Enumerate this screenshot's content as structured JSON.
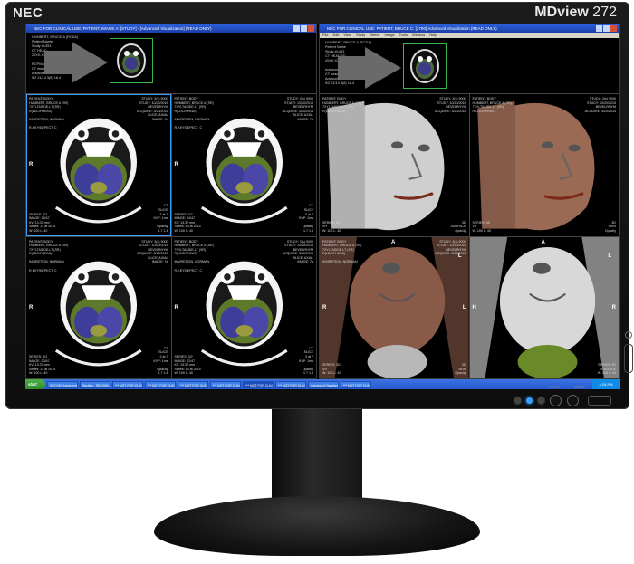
{
  "monitor": {
    "brand": "NEC",
    "model_prefix": "MDview",
    "model_number": "272",
    "button_labels": [
      "INPUT",
      "MENU"
    ]
  },
  "left_viewer": {
    "title": "NEC FOR CLINICAL USE: PATIENT, IMAGE A: [STUDY] - [Advanced Visualization] (READ ONLY)",
    "header_text": "HUMBERT, BRUCE A (RCDA)\nPatient Name\nStudy #1453\nCT HEAD\n20XX-XX-XX 15:28\n\nRCPI/Medical Systems\nCT head No Contrast\nAdvanced Reader\n9/2 21/14 3(8) 18.4",
    "accent_color": "#39b54a",
    "images": [
      {
        "tl": "PATIENT: BODY\nHUMBERT, BRUCE A (SR)\n7XYLTASIDE-LT (SR)\nR(LDC/PHEAS)\n\nINVIRETION, NORMAN\n\nR-KEYSIEPECT, C",
        "tr": "STUDY: 3(s) 9000\nSTUDY: 10/20/2015\nBEVELRHYM\nACQUIRE: 3/20/2015\nSLICE: AXIAL\nIMAGE: 7a",
        "bl": "SERIES: 3/2\nIMAGE: 25/47\nKV: 13.37 mm\nSeries: 13 at 2015\nW: 100 L: 40",
        "br": "CT\nSLICE\n3 at 7\nKVP: 1ms\n\nOpacity\n1.7 1.4",
        "orient": "R"
      },
      {
        "tl": "PATIENT: BODY\nHUMBERT, BRUCE A (SR)\n7XYLTASIDE-LT (SR)\nR(LDC/PHEAS)\n\nINVIRETION, NORMAN\n\nR-KEYSIEPECT, C",
        "tr": "STUDY: 3(s) 9000\nSTUDY: 10/20/2015\nBEVELRHYM\nACQUIRE: 3/20/2015\nSLICE: AXIAL\nIMAGE: 7a",
        "bl": "SERIES: 3/2\nIMAGE: 24/47\nKV: 13.37 mm\nSeries: 13 at 2015\nW: 100 L: 40",
        "br": "CT\nSLICE\n3 at 7\nKVP: 1ms\n\nOpacity\n1.7 1.4",
        "orient": "R"
      },
      {
        "tl": "PATIENT: BODY\nHUMBERT, BRUCE A (SR)\n7XYLTASIDE-LT (SR)\nR(LDC/PHEAS)\n\nINVIRETION, NORMAN\n\nR-KEYSIEPECT, C",
        "tr": "STUDY: 3(s) 9000\nSTUDY: 10/20/2015\nBEVELRHYM\nACQUIRE: 3/20/2015\nSLICE: AXIAL\nIMAGE: 7a",
        "bl": "SERIES: 3/2\nIMAGE: 23/47\nKV: 13.37 mm\nSeries: 13 at 2015\nW: 100 L: 40",
        "br": "CT\nSLICE\n3 at 7\nKVP: 1ms\n\nOpacity\n1.7 1.4",
        "orient": "R"
      },
      {
        "tl": "PATIENT: BODY\nHUMBERT, BRUCE A (SR)\n7XYLTASIDE-LT (SR)\nR(LDC/PHEAS)\n\nINVIRETION, NORMAN\n\nR-KEYSIEPECT, C",
        "tr": "STUDY: 3(s) 9000\nSTUDY: 10/20/2015\nBEVELRHYM\nACQUIRE: 3/20/2015\nSLICE: AXIAL\nIMAGE: 7a",
        "bl": "SERIES: 3/2\nIMAGE: 22/47\nKV: 13.37 mm\nSeries: 13 at 2015\nW: 100 L: 40",
        "br": "CT\nSLICE\n3 at 7\nKVP: 1ms\n\nOpacity\n1.7 1.4",
        "orient": "R"
      }
    ]
  },
  "right_viewer": {
    "title": "NEC FOR CLINICAL USE: PATIENT, BRUCE C: [3790] Advanced Visualization (READ ONLY)",
    "menu": [
      "File",
      "Edit",
      "View",
      "Study",
      "Series",
      "Image",
      "Tools",
      "Window",
      "Help"
    ],
    "header_text": "HUMBERT, BRUCE A (RCDA)\nPatient Name\nStudy #1453\nCT HEAD 3D\n20XX-XX-XX 15:28\n\nAdvanced Medical Systems\nCT head No Contrast\nAdvanced Reader\n9/2 21/14 3(8) 18.4",
    "images": [
      {
        "tl": "PATIENT: BODY\nHUMBERT, BRUCE A (SR)\n7XYLTASIDE-LT (SR)\nR(LDC/PHEAS)",
        "tr": "STUDY: 3(s) 9000\nSTUDY: 10/20/2015\nBEVELRHYM\nACQUIRE: 3/20/2015",
        "bl": "SERIES: 3D\nVR\nW: 100 L: 40",
        "br": "3D\nSURFACE\nOpacity",
        "labels": []
      },
      {
        "tl": "PATIENT: BODY\nHUMBERT, BRUCE A (SR)\n7XYLTASIDE-LT (SR)\nR(LDC/PHEAS)",
        "tr": "STUDY: 3(s) 9000\nSTUDY: 10/20/2015\nBEVELRHYM\nACQUIRE: 3/20/2015",
        "bl": "SERIES: 3D\nVR\nW: 100 L: 40",
        "br": "3D\nSKIN\nOpacity",
        "labels": []
      },
      {
        "tl": "PATIENT: BODY\nHUMBERT, BRUCE A (SR)\n7XYLTASIDE-LT (SR)\nR(LDC/PHEAS)\n\nINVIRETION, NORMAN",
        "tr": "STUDY: 3(s) 9000\nSTUDY: 10/20/2015\nBEVELRHYM\nACQUIRE: 3/20/2015",
        "bl": "SERIES: 3D\nVR\nW: 100 L: 40",
        "br": "3D\nSKIN\nOpacity",
        "labels": [
          "A",
          "R",
          "L",
          "L"
        ]
      },
      {
        "tl": "",
        "tr": "",
        "bl": "",
        "br": "SERIES: 3D\nSURFACE\nW: 100 L: 40",
        "labels": [
          "A",
          "H",
          "R",
          "L"
        ]
      }
    ]
  },
  "taskbar": {
    "start_label": "start",
    "items": [
      "[DICOM] Advanced Vis...",
      "Studies - [DICOM] Adv...",
      "*** NOT FOR CLINICA...",
      "*** NOT FOR CLINICA...",
      "*** NOT FOR CLINICA...",
      "*** NOT FOR CLINICA...",
      "*** NOT FOR CLINICA...",
      "*** NOT FOR CLINICA...",
      "Advanced Visualizati...",
      "*** NOT FOR CLINICA..."
    ],
    "active_index": 6,
    "tray_time": "4:28 PM"
  }
}
